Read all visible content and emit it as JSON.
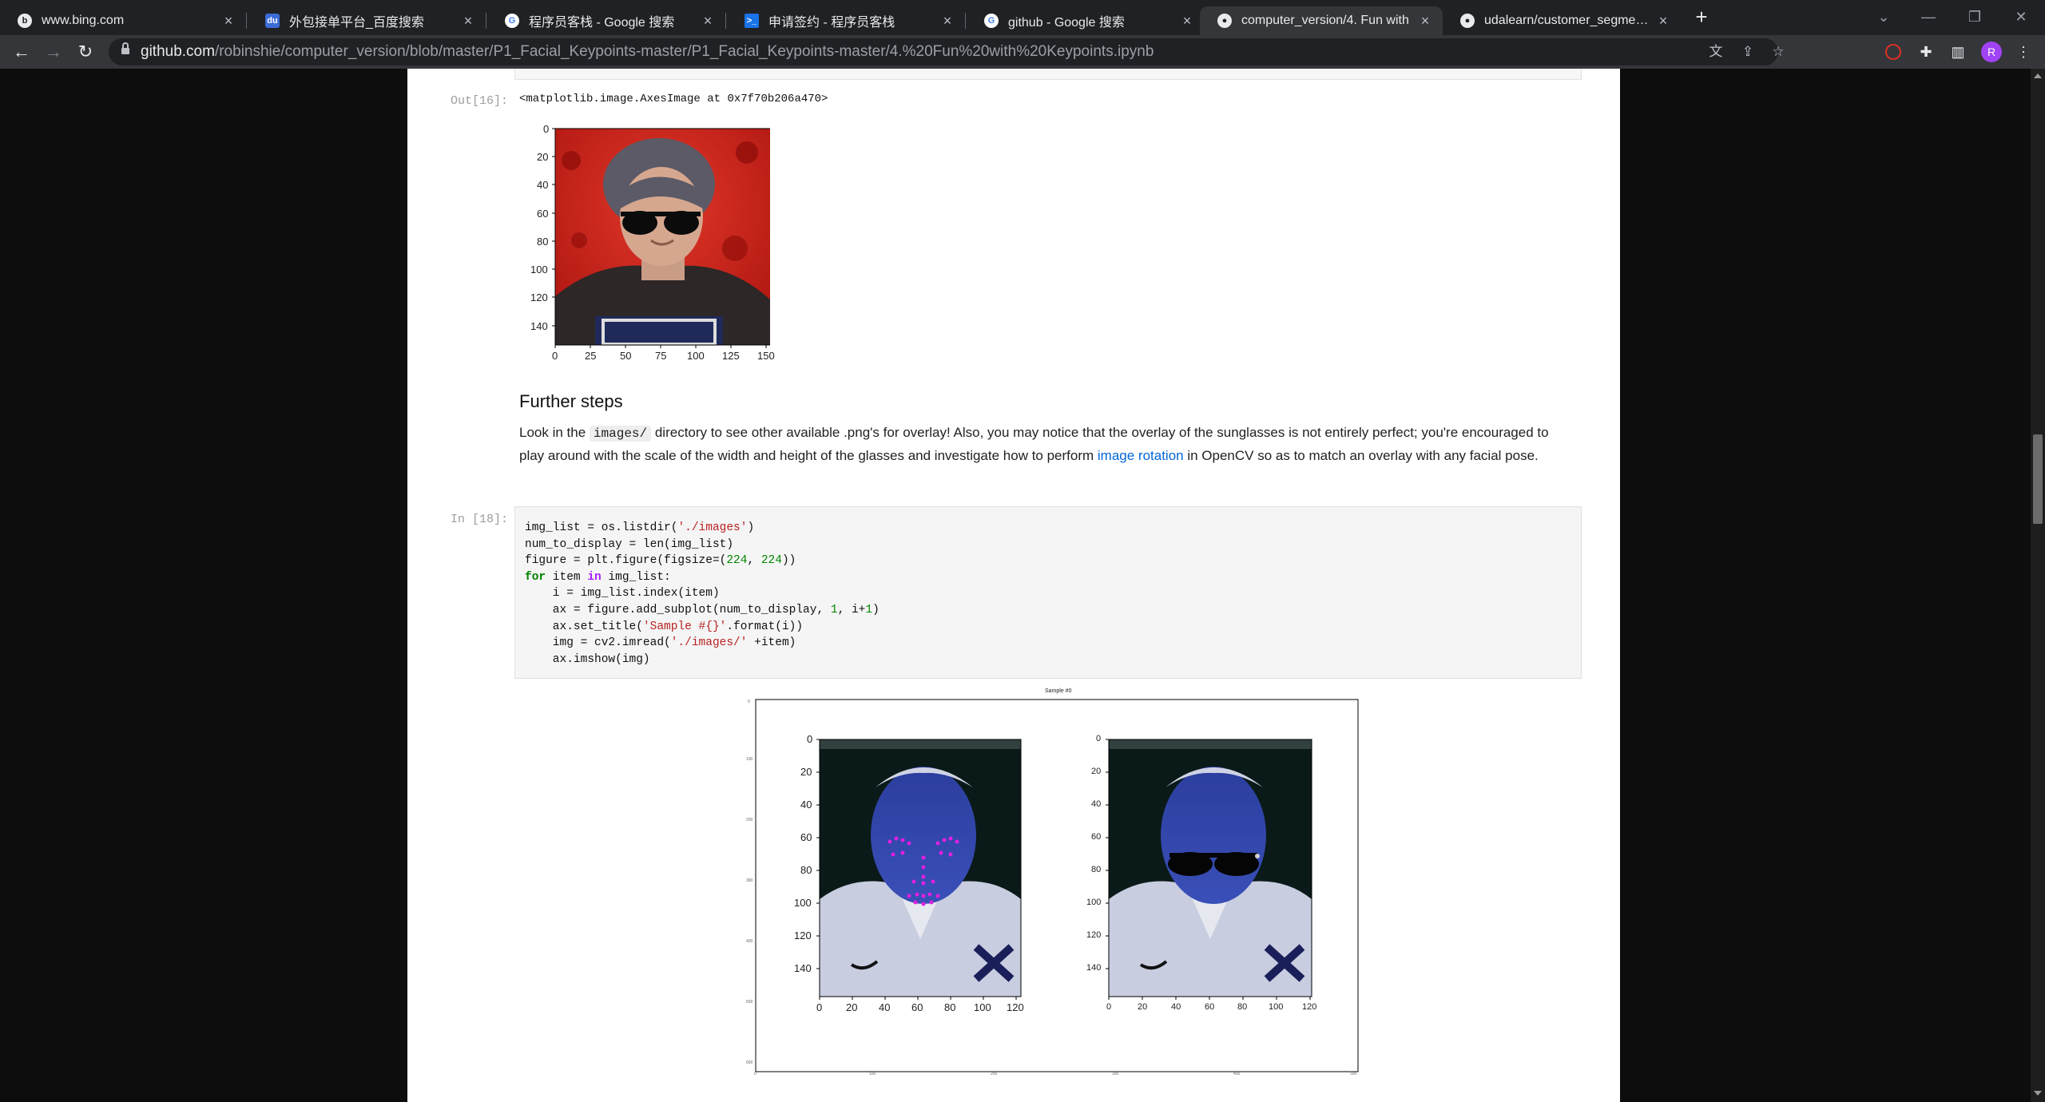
{
  "tabs": [
    {
      "title": "www.bing.com",
      "favicon": "bing-icon"
    },
    {
      "title": "外包接单平台_百度搜索",
      "favicon": "baidu-icon"
    },
    {
      "title": "程序员客栈 - Google 搜索",
      "favicon": "google-icon"
    },
    {
      "title": "申请签约 - 程序员客栈",
      "favicon": "proginn-icon"
    },
    {
      "title": "github - Google 搜索",
      "favicon": "google-icon"
    },
    {
      "title": "computer_version/4. Fun with",
      "favicon": "github-icon",
      "active": true
    },
    {
      "title": "udalearn/customer_segments",
      "favicon": "github-icon"
    }
  ],
  "toolbar": {
    "url_host": "github.com",
    "url_path": "/robinshie/computer_version/blob/master/P1_Facial_Keypoints-master/P1_Facial_Keypoints-master/4.%20Fun%20with%20Keypoints.ipynb",
    "avatar_letter": "R"
  },
  "notebook": {
    "out16_prompt": "Out[16]:",
    "out16_text": "<matplotlib.image.AxesImage at 0x7f70b206a470>",
    "small_plot": {
      "y_ticks": [
        "0",
        "20",
        "40",
        "60",
        "80",
        "100",
        "120",
        "140"
      ],
      "x_ticks": [
        "0",
        "25",
        "50",
        "75",
        "100",
        "125",
        "150"
      ]
    },
    "heading": "Further steps",
    "para_1": "Look in the ",
    "para_code": "images/",
    "para_2": " directory to see other available .png's for overlay! Also, you may notice that the overlay of the sunglasses is not entirely perfect; you're encouraged to play around with the scale of the width and height of the glasses and investigate how to perform ",
    "para_link": "image rotation",
    "para_3": " in OpenCV so as to match an overlay with any facial pose.",
    "in18_prompt": "In [18]:",
    "big_fig": {
      "title": "Sample #0",
      "panel_y_ticks": [
        "0",
        "20",
        "40",
        "60",
        "80",
        "100",
        "120",
        "140"
      ],
      "panel_x_ticks": [
        "0",
        "20",
        "40",
        "60",
        "80",
        "100",
        "120"
      ]
    }
  },
  "colors": {
    "link": "#0366d6",
    "chrome_dark": "#202124",
    "chrome_toolbar": "#35363a"
  }
}
